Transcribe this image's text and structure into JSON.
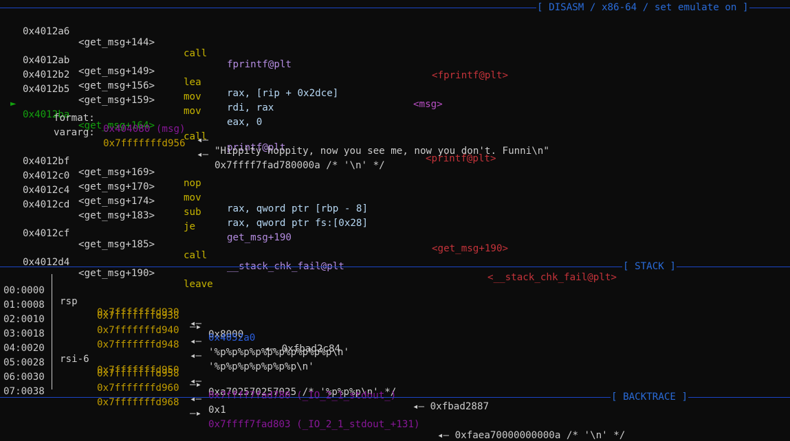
{
  "disasm": {
    "title": "[ DISASM / x86-64 / set emulate on ]",
    "rows": [
      {
        "marker": "",
        "addr": "0x4012a6",
        "sym": "<get_msg+144>",
        "mn": "call",
        "ops": "fprintf@plt",
        "annot": "<fprintf@plt>"
      },
      {
        "marker": "",
        "addr": "0x4012ab",
        "sym": "<get_msg+149>",
        "mn": "lea",
        "ops": "rax, [rip + 0x2dce]",
        "annot": "<msg>"
      },
      {
        "marker": "",
        "addr": "0x4012b2",
        "sym": "<get_msg+156>",
        "mn": "mov",
        "ops": "rdi, rax",
        "annot": ""
      },
      {
        "marker": "",
        "addr": "0x4012b5",
        "sym": "<get_msg+159>",
        "mn": "mov",
        "ops": "eax, 0",
        "annot": ""
      },
      {
        "marker": "►",
        "addr": "0x4012ba",
        "sym": "<get_msg+164>",
        "mn": "call",
        "ops": "printf@plt",
        "annot": "<printf@plt>"
      },
      {
        "marker": "",
        "addr": "0x4012bf",
        "sym": "<get_msg+169>",
        "mn": "nop",
        "ops": "",
        "annot": ""
      },
      {
        "marker": "",
        "addr": "0x4012c0",
        "sym": "<get_msg+170>",
        "mn": "mov",
        "ops": "rax, qword ptr [rbp - 8]",
        "annot": ""
      },
      {
        "marker": "",
        "addr": "0x4012c4",
        "sym": "<get_msg+174>",
        "mn": "sub",
        "ops": "rax, qword ptr fs:[0x28]",
        "annot": ""
      },
      {
        "marker": "",
        "addr": "0x4012cd",
        "sym": "<get_msg+183>",
        "mn": "je",
        "ops": "get_msg+190",
        "annot": "<get_msg+190>"
      },
      {
        "marker": "",
        "addr": "0x4012cf",
        "sym": "<get_msg+185>",
        "mn": "call",
        "ops": "__stack_chk_fail@plt",
        "annot": "<__stack_chk_fail@plt>"
      },
      {
        "marker": "",
        "addr": "0x4012d4",
        "sym": "<get_msg+190>",
        "mn": "leave",
        "ops": "",
        "annot": ""
      }
    ],
    "args": [
      {
        "label": "format:",
        "value": "0x404080 (msg)",
        "arrow": "◂—",
        "rest": "\"Hippity hoppity, now you see me, now you don't. Funni\\n\""
      },
      {
        "label": "vararg:",
        "value": "0x7fffffffd956",
        "arrow": "◂—",
        "rest": "0x7ffff7fad780000a /* '\\n' */"
      }
    ]
  },
  "stack": {
    "title": "[ STACK ]",
    "rows": [
      {
        "idx": "00:0000",
        "reg": "rsp",
        "addr": "0x7fffffffd930",
        "arrow": "◂—",
        "target": "",
        "rest": "0x8000"
      },
      {
        "idx": "01:0008",
        "reg": "",
        "addr": "0x7fffffffd938",
        "arrow": "—▸",
        "target": "0x4052a0",
        "rest": "◂— 0xfbad2c84"
      },
      {
        "idx": "02:0010",
        "reg": "",
        "addr": "0x7fffffffd940",
        "arrow": "◂—",
        "target": "",
        "rest": "'%p%p%p%p%p%p%p%p%p%p\\n'"
      },
      {
        "idx": "03:0018",
        "reg": "",
        "addr": "0x7fffffffd948",
        "arrow": "◂—",
        "target": "",
        "rest": "'%p%p%p%p%p%p%p\\n'"
      },
      {
        "idx": "04:0020",
        "reg": "rsi-6",
        "addr": "0x7fffffffd950",
        "arrow": "◂—",
        "target": "",
        "rest": "0xa702570257025 /* '%p%p%p\\n' */"
      },
      {
        "idx": "05:0028",
        "reg": "",
        "addr": "0x7fffffffd958",
        "arrow": "—▸",
        "target": "0x7ffff7fad780 (_IO_2_1_stdout_)",
        "rest": "◂— 0xfbad2887"
      },
      {
        "idx": "06:0030",
        "reg": "",
        "addr": "0x7fffffffd960",
        "arrow": "◂—",
        "target": "",
        "rest": "0x1"
      },
      {
        "idx": "07:0038",
        "reg": "",
        "addr": "0x7fffffffd968",
        "arrow": "—▸",
        "target": "0x7ffff7fad803 (_IO_2_1_stdout_+131)",
        "rest": "◂— 0xfaea70000000000a /* '\\n' */"
      }
    ]
  },
  "backtrace": {
    "title": "[ BACKTRACE ]"
  }
}
